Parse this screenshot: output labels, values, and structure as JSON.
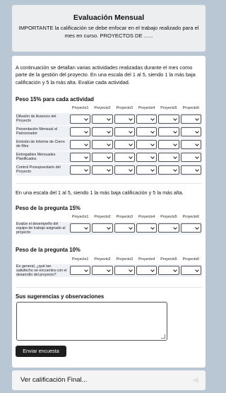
{
  "header": {
    "title": "Evaluación Mensual",
    "subtitle": "IMPORTANTE la calificación se debe enfocar en el trabajo realizado para el mes en curso. PROYECTOS DE ......"
  },
  "intro": "A continuación se detallan varias actividades realizadas durante el mes como parte de la gestión del proyecto. En una escala del 1 al 5, siendo 1 la más baja calificación y 5 la más alta. Evalúe cada actividad.",
  "section1": {
    "title": "Peso 15% para cada actividad",
    "columns": [
      "Proyecto1",
      "Proyecto2",
      "Proyecto3",
      "Proyecto4",
      "Proyecto5",
      "Proyecto6"
    ],
    "rows": [
      "Difusión de Avances del Proyecto",
      "Presentación Mensual al Patrocinador",
      "Emisión de Informe de Cierre de Mes",
      "Entregables Mensuales Planificados",
      "Control Presupuestario del Proyecto"
    ]
  },
  "scale_text": "En una escala del 1 al 5, siendo 1 la más baja calificación y 5 la más alta.",
  "section2": {
    "title": "Peso de la pregunta 15%",
    "columns": [
      "Proyecto1",
      "Proyecto2",
      "Proyecto3",
      "Proyecto4",
      "Proyecto5",
      "Proyecto6"
    ],
    "rows": [
      "Evalúe el desempeño del equipo de trabajo asignado al proyecto"
    ]
  },
  "section3": {
    "title": "Peso de la pregunta 10%",
    "columns": [
      "Proyecto1",
      "Proyecto2",
      "Proyecto3",
      "Proyecto4",
      "Proyecto5",
      "Proyecto6"
    ],
    "rows": [
      "En general, ¿qué tan satisfecho se encuentra con el desarrollo del proyecto?"
    ]
  },
  "suggestions": {
    "title": "Sus sugerencias y observaciones"
  },
  "submit_label": "Enviar encuesta",
  "final": {
    "label": "Ver calificación Final..."
  }
}
